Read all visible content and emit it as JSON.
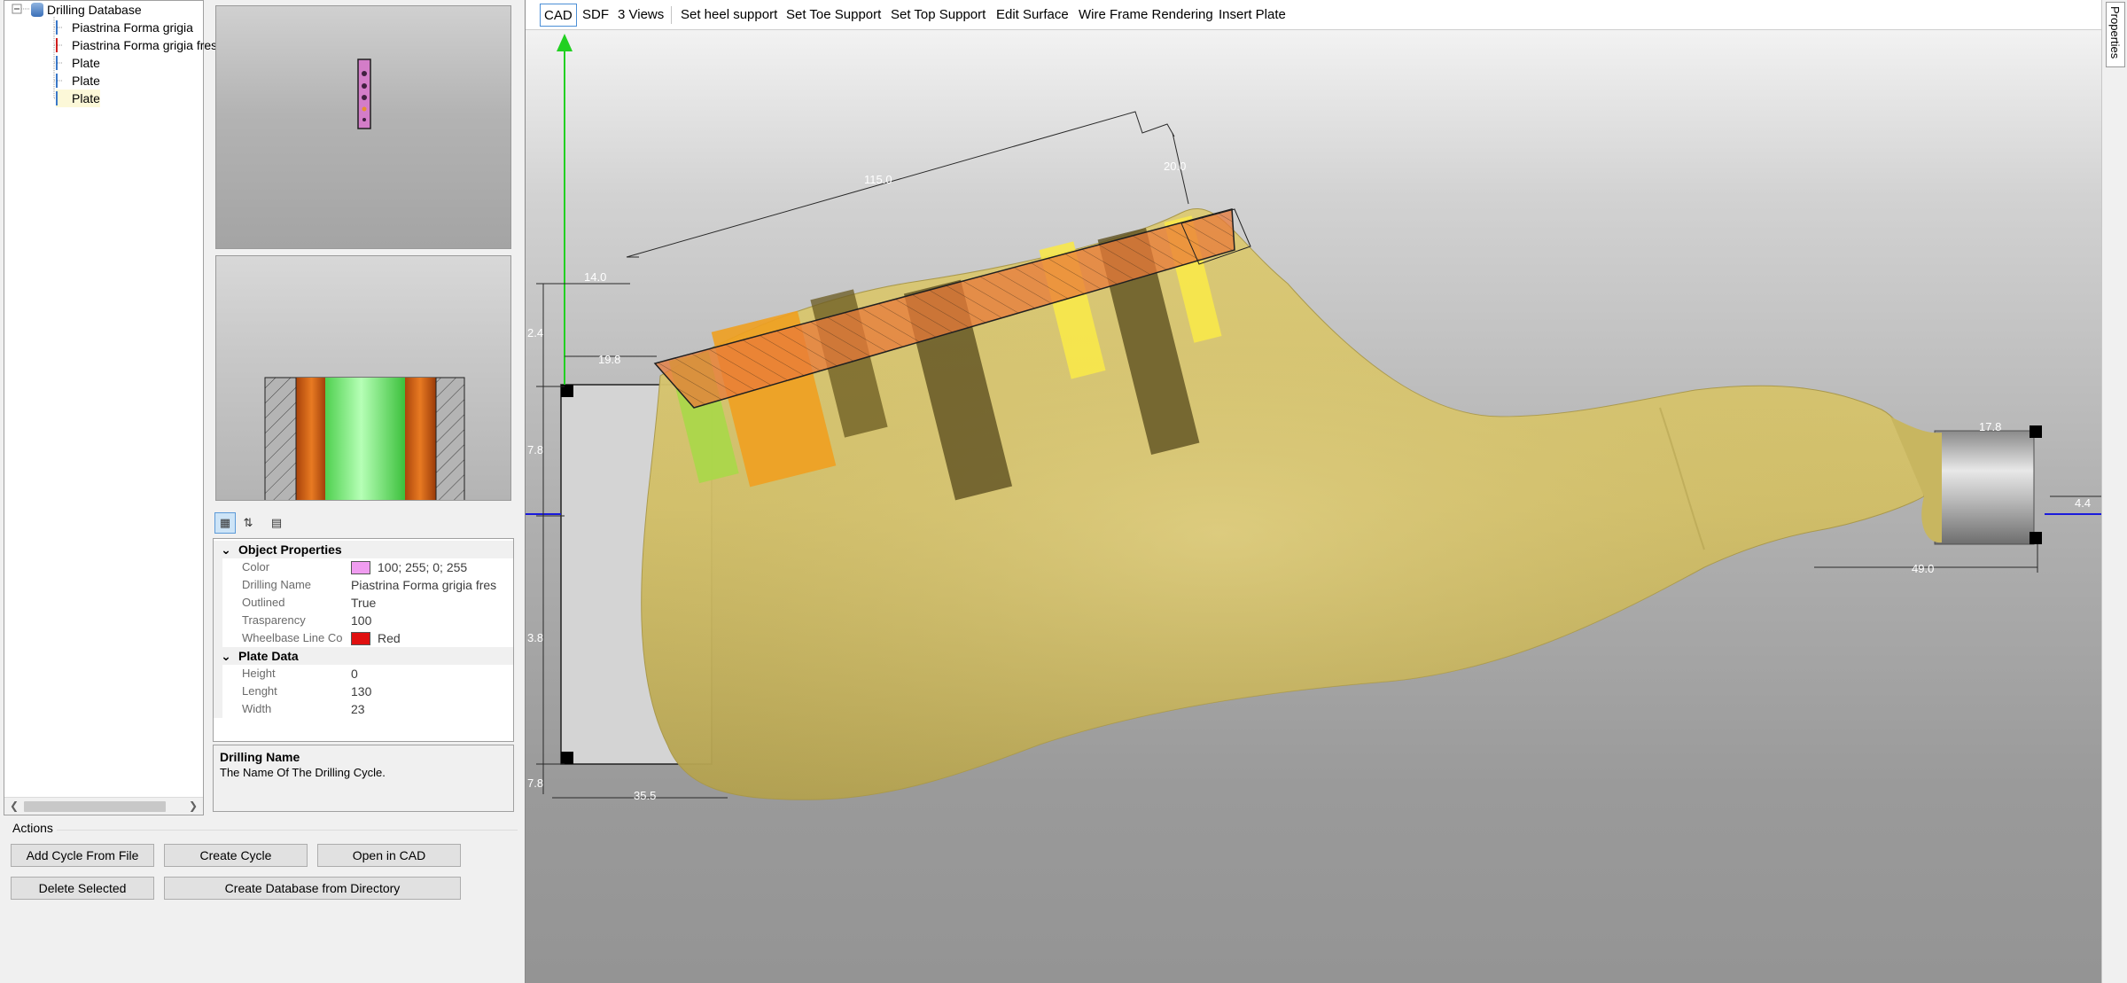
{
  "tree": {
    "root": "Drilling Database",
    "items": [
      "Piastrina Forma grigia",
      "Piastrina Forma grigia fres",
      "Plate",
      "Plate",
      "Plate"
    ]
  },
  "property_toolbar": {
    "categorized_icon": "categorized-icon",
    "alphabetical_icon": "sort-az-icon",
    "pages_icon": "property-pages-icon"
  },
  "properties": {
    "object_category": "Object Properties",
    "object_rows": [
      {
        "name": "Color",
        "value": "100; 255; 0; 255",
        "swatch": "#f09cf0"
      },
      {
        "name": "Drilling Name",
        "value": "Piastrina Forma grigia fres"
      },
      {
        "name": "Outlined",
        "value": "True"
      },
      {
        "name": "Trasparency",
        "value": "100"
      },
      {
        "name": "Wheelbase Line Co",
        "value": "Red",
        "swatch": "#e01010"
      }
    ],
    "plate_category": "Plate Data",
    "plate_rows": [
      {
        "name": "Height",
        "value": "0"
      },
      {
        "name": "Lenght",
        "value": "130"
      },
      {
        "name": "Width",
        "value": "23"
      }
    ]
  },
  "description": {
    "title": "Drilling Name",
    "text": "The Name Of The Drilling Cycle."
  },
  "actions": {
    "title": "Actions",
    "add_cycle": "Add  Cycle From File",
    "create_cycle": "Create Cycle",
    "open_cad": "Open in CAD",
    "delete_selected": "Delete Selected",
    "create_db": "Create Database from Directory"
  },
  "cad_toolbar": {
    "items": [
      "CAD",
      "SDF",
      "3 Views",
      "Set heel support",
      "Set Toe Support",
      "Set Top Support",
      "Edit Surface",
      "Wire Frame Rendering",
      "Insert Plate"
    ]
  },
  "dimensions": {
    "d115": "115.0",
    "d20": "20.0",
    "d14": "14.0",
    "d19_8": "19.8",
    "d2_4": "2.4",
    "d7_8": "7.8",
    "d3_8": "3.8",
    "d7_8b": "7.8",
    "d35_5": "35.5",
    "d17_8": "17.8",
    "d4_4": "4.4",
    "d49": "49.0"
  },
  "side_panel": {
    "tab": "Properties"
  },
  "colors": {
    "last": "#d2c066",
    "plate": "#e87a3a",
    "axis_green": "#22d022",
    "axis_blue": "#1a1adc"
  }
}
